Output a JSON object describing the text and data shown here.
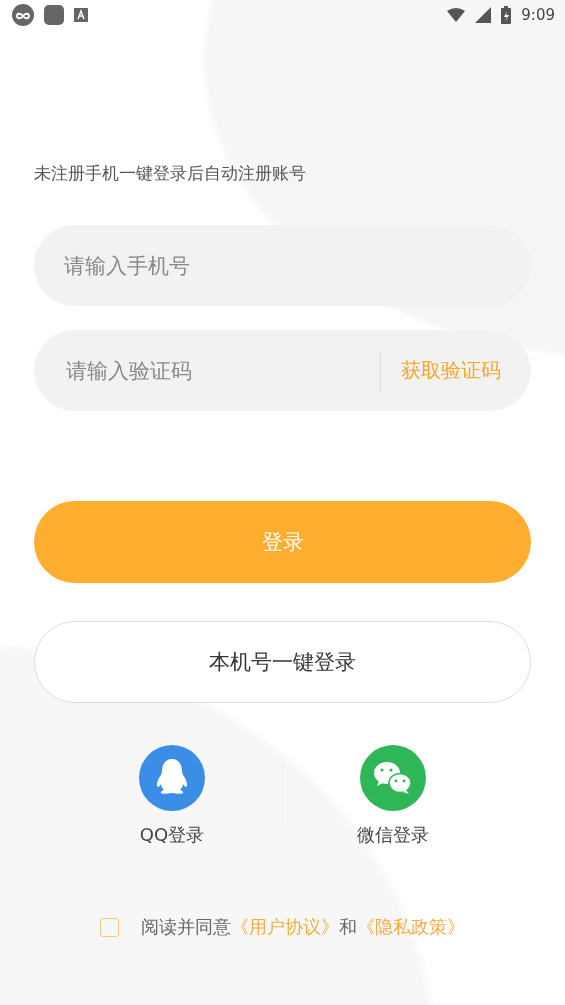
{
  "status_bar": {
    "time": "9:09"
  },
  "hint": "未注册手机一键登录后自动注册账号",
  "phone_field": {
    "placeholder": "请输入手机号"
  },
  "code_field": {
    "placeholder": "请输入验证码",
    "action": "获取验证码"
  },
  "login_button": "登录",
  "one_key_button": "本机号一键登录",
  "social_logins": [
    {
      "kind": "qq",
      "label": "QQ登录"
    },
    {
      "kind": "wechat",
      "label": "微信登录"
    }
  ],
  "agreement": {
    "checked": false,
    "prefix": "阅读并同意",
    "first_link": "《用户协议》",
    "joiner": "和",
    "second_link": "《隐私政策》"
  }
}
